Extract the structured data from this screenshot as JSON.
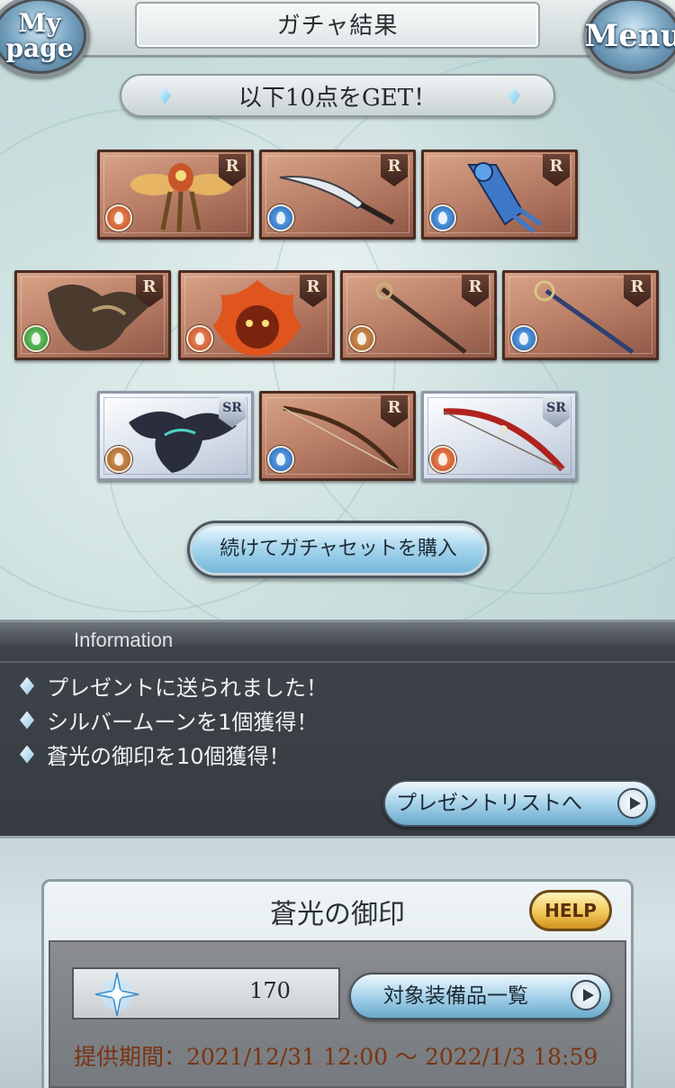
{
  "header": {
    "title": "ガチャ結果",
    "mypage_label": "My page",
    "menu_label": "Menu"
  },
  "result": {
    "banner": "以下10点をGET！",
    "items": [
      {
        "rarity": "R",
        "element": "fire",
        "art": "insect-creature"
      },
      {
        "rarity": "R",
        "element": "water",
        "art": "blade"
      },
      {
        "rarity": "R",
        "element": "water",
        "art": "gauntlet"
      },
      {
        "rarity": "R",
        "element": "wind",
        "art": "griffin"
      },
      {
        "rarity": "R",
        "element": "fire",
        "art": "flame-spirit"
      },
      {
        "rarity": "R",
        "element": "earth",
        "art": "staff"
      },
      {
        "rarity": "R",
        "element": "water",
        "art": "scepter"
      },
      {
        "rarity": "SR",
        "element": "earth",
        "art": "dragon"
      },
      {
        "rarity": "R",
        "element": "water",
        "art": "bow"
      },
      {
        "rarity": "SR",
        "element": "fire",
        "art": "red-bow"
      }
    ],
    "continue_button": "続けてガチャセットを購入"
  },
  "information": {
    "title": "Information",
    "messages": [
      "プレゼントに送られました！",
      "シルバームーンを1個獲得！",
      "蒼光の御印を10個獲得！"
    ],
    "present_button": "プレゼントリストへ"
  },
  "seal": {
    "title": "蒼光の御印",
    "help_button": "HELP",
    "count": "170",
    "equipment_button": "対象装備品一覧",
    "period": "提供期間：2021/12/31 12:00 〜 2022/1/3 18:59"
  },
  "colors": {
    "fire": "#c14321",
    "water": "#1f5bb3",
    "wind": "#2a8a2e",
    "earth": "#9a5a24",
    "period_text": "#7a3414",
    "help": "#f2c75a"
  }
}
